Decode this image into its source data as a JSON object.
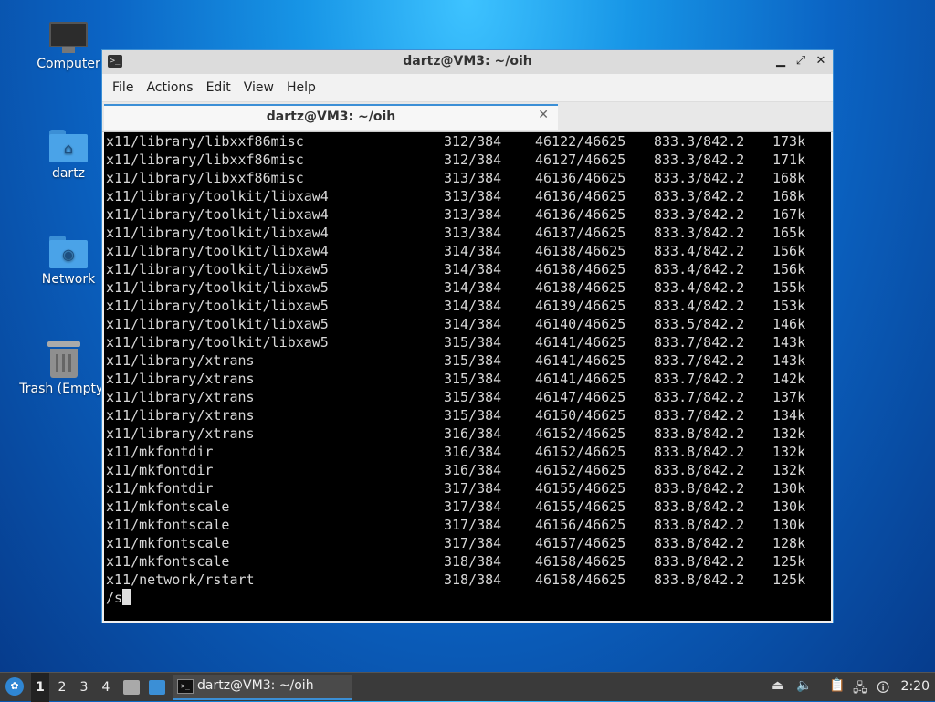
{
  "desktop": {
    "icons": [
      {
        "label": "Computer",
        "icon": "computer-icon"
      },
      {
        "label": "dartz",
        "icon": "home-folder-icon"
      },
      {
        "label": "Network",
        "icon": "network-folder-icon"
      },
      {
        "label": "Trash (Empty)",
        "icon": "trash-icon"
      }
    ]
  },
  "window": {
    "title": "dartz@VM3: ~/oih",
    "controls": {
      "minimize": "▁",
      "maximize": "⤢",
      "close": "✕"
    },
    "menu": [
      "File",
      "Actions",
      "Edit",
      "View",
      "Help"
    ],
    "tab": {
      "title": "dartz@VM3: ~/oih",
      "close": "✕"
    }
  },
  "terminal": {
    "lines": [
      {
        "path": "x11/library/libxxf86misc",
        "pkg": "312/384",
        "files": "46122/46625",
        "size": "833.3/842.2",
        "speed": "173k"
      },
      {
        "path": "x11/library/libxxf86misc",
        "pkg": "312/384",
        "files": "46127/46625",
        "size": "833.3/842.2",
        "speed": "171k"
      },
      {
        "path": "x11/library/libxxf86misc",
        "pkg": "313/384",
        "files": "46136/46625",
        "size": "833.3/842.2",
        "speed": "168k"
      },
      {
        "path": "x11/library/toolkit/libxaw4",
        "pkg": "313/384",
        "files": "46136/46625",
        "size": "833.3/842.2",
        "speed": "168k"
      },
      {
        "path": "x11/library/toolkit/libxaw4",
        "pkg": "313/384",
        "files": "46136/46625",
        "size": "833.3/842.2",
        "speed": "167k"
      },
      {
        "path": "x11/library/toolkit/libxaw4",
        "pkg": "313/384",
        "files": "46137/46625",
        "size": "833.3/842.2",
        "speed": "165k"
      },
      {
        "path": "x11/library/toolkit/libxaw4",
        "pkg": "314/384",
        "files": "46138/46625",
        "size": "833.4/842.2",
        "speed": "156k"
      },
      {
        "path": "x11/library/toolkit/libxaw5",
        "pkg": "314/384",
        "files": "46138/46625",
        "size": "833.4/842.2",
        "speed": "156k"
      },
      {
        "path": "x11/library/toolkit/libxaw5",
        "pkg": "314/384",
        "files": "46138/46625",
        "size": "833.4/842.2",
        "speed": "155k"
      },
      {
        "path": "x11/library/toolkit/libxaw5",
        "pkg": "314/384",
        "files": "46139/46625",
        "size": "833.4/842.2",
        "speed": "153k"
      },
      {
        "path": "x11/library/toolkit/libxaw5",
        "pkg": "314/384",
        "files": "46140/46625",
        "size": "833.5/842.2",
        "speed": "146k"
      },
      {
        "path": "x11/library/toolkit/libxaw5",
        "pkg": "315/384",
        "files": "46141/46625",
        "size": "833.7/842.2",
        "speed": "143k"
      },
      {
        "path": "x11/library/xtrans",
        "pkg": "315/384",
        "files": "46141/46625",
        "size": "833.7/842.2",
        "speed": "143k"
      },
      {
        "path": "x11/library/xtrans",
        "pkg": "315/384",
        "files": "46141/46625",
        "size": "833.7/842.2",
        "speed": "142k"
      },
      {
        "path": "x11/library/xtrans",
        "pkg": "315/384",
        "files": "46147/46625",
        "size": "833.7/842.2",
        "speed": "137k"
      },
      {
        "path": "x11/library/xtrans",
        "pkg": "315/384",
        "files": "46150/46625",
        "size": "833.7/842.2",
        "speed": "134k"
      },
      {
        "path": "x11/library/xtrans",
        "pkg": "316/384",
        "files": "46152/46625",
        "size": "833.8/842.2",
        "speed": "132k"
      },
      {
        "path": "x11/mkfontdir",
        "pkg": "316/384",
        "files": "46152/46625",
        "size": "833.8/842.2",
        "speed": "132k"
      },
      {
        "path": "x11/mkfontdir",
        "pkg": "316/384",
        "files": "46152/46625",
        "size": "833.8/842.2",
        "speed": "132k"
      },
      {
        "path": "x11/mkfontdir",
        "pkg": "317/384",
        "files": "46155/46625",
        "size": "833.8/842.2",
        "speed": "130k"
      },
      {
        "path": "x11/mkfontscale",
        "pkg": "317/384",
        "files": "46155/46625",
        "size": "833.8/842.2",
        "speed": "130k"
      },
      {
        "path": "x11/mkfontscale",
        "pkg": "317/384",
        "files": "46156/46625",
        "size": "833.8/842.2",
        "speed": "130k"
      },
      {
        "path": "x11/mkfontscale",
        "pkg": "317/384",
        "files": "46157/46625",
        "size": "833.8/842.2",
        "speed": "128k"
      },
      {
        "path": "x11/mkfontscale",
        "pkg": "318/384",
        "files": "46158/46625",
        "size": "833.8/842.2",
        "speed": "125k"
      },
      {
        "path": "x11/network/rstart",
        "pkg": "318/384",
        "files": "46158/46625",
        "size": "833.8/842.2",
        "speed": "125k"
      }
    ],
    "prompt_text": "/s"
  },
  "taskbar": {
    "workspaces": [
      "1",
      "2",
      "3",
      "4"
    ],
    "active_workspace": "1",
    "task_label": "dartz@VM3: ~/oih",
    "clock": "2:20",
    "accent": "#3b8fd6"
  }
}
